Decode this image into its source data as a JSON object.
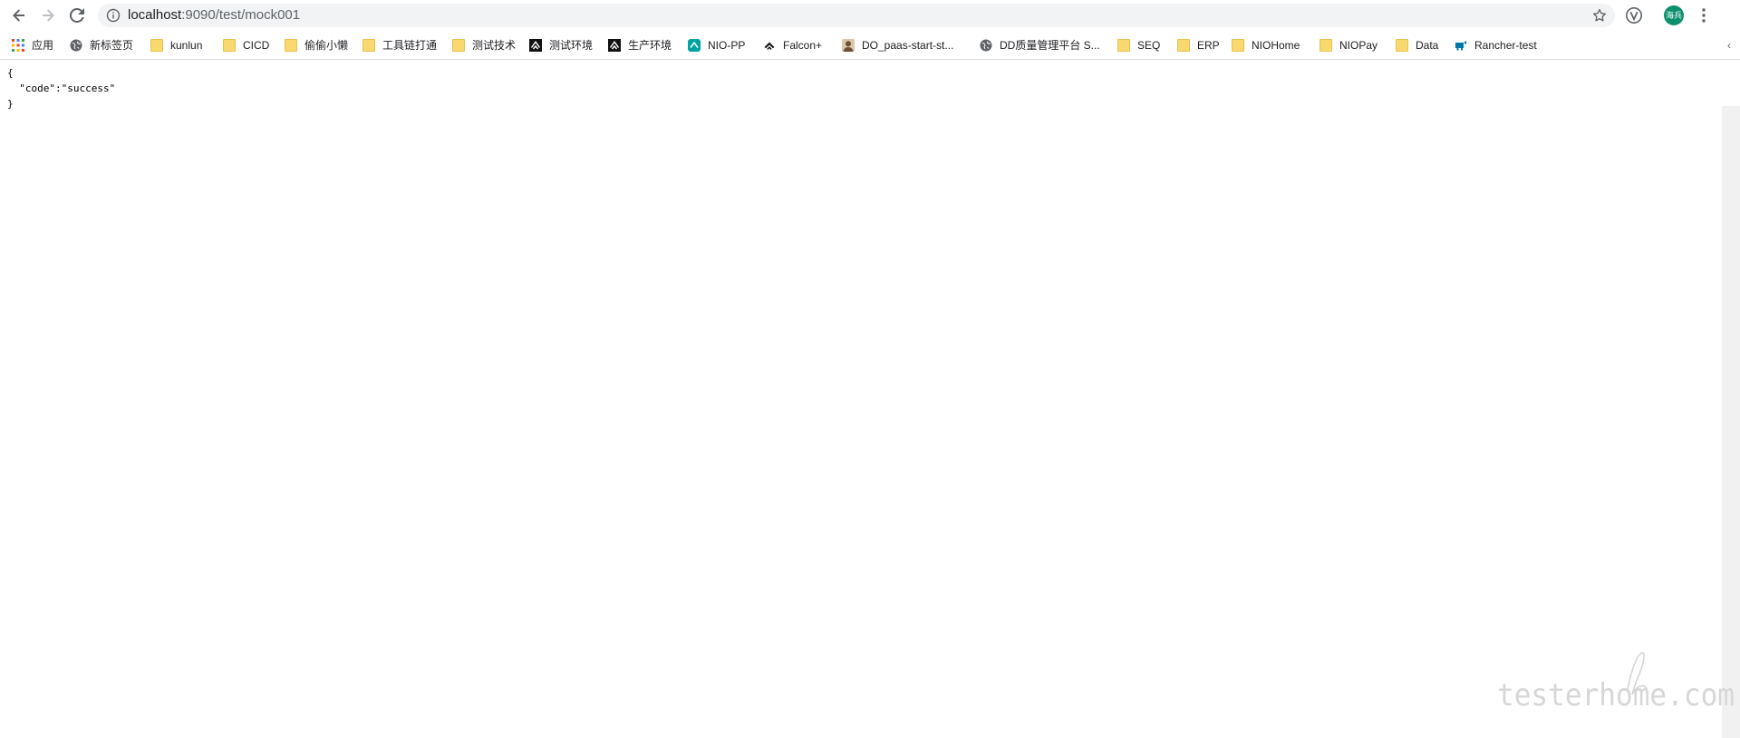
{
  "browser": {
    "url_host": "localhost",
    "url_rest": ":9090/test/mock001",
    "profile_initials": "海兵"
  },
  "bookmarks": [
    {
      "label": "应用",
      "icon": "apps-grid-icon"
    },
    {
      "label": "新标签页",
      "icon": "globe-icon"
    },
    {
      "label": "kunlun",
      "icon": "folder-icon"
    },
    {
      "label": "CICD",
      "icon": "folder-icon"
    },
    {
      "label": "偷偷小懒",
      "icon": "folder-icon"
    },
    {
      "label": "工具链打通",
      "icon": "folder-icon"
    },
    {
      "label": "测试技术",
      "icon": "folder-icon"
    },
    {
      "label": "测试环境",
      "icon": "nio-logo-icon"
    },
    {
      "label": "生产环境",
      "icon": "nio-logo-icon"
    },
    {
      "label": "NIO-PP",
      "icon": "nio-pp-icon"
    },
    {
      "label": "Falcon+",
      "icon": "falcon-icon"
    },
    {
      "label": "DO_paas-start-st...",
      "icon": "avatar-portrait-icon"
    },
    {
      "label": "DD质量管理平台 S...",
      "icon": "globe-icon"
    },
    {
      "label": "SEQ",
      "icon": "folder-icon"
    },
    {
      "label": "ERP",
      "icon": "folder-icon"
    },
    {
      "label": "NIOHome",
      "icon": "folder-icon"
    },
    {
      "label": "NIOPay",
      "icon": "folder-icon"
    },
    {
      "label": "Data",
      "icon": "folder-icon"
    },
    {
      "label": "Rancher-test",
      "icon": "rancher-icon"
    }
  ],
  "json_view": {
    "open_brace": "{",
    "line": "  \"code\":\"success\"",
    "close_brace": "}"
  },
  "watermark": "testerhome.com"
}
